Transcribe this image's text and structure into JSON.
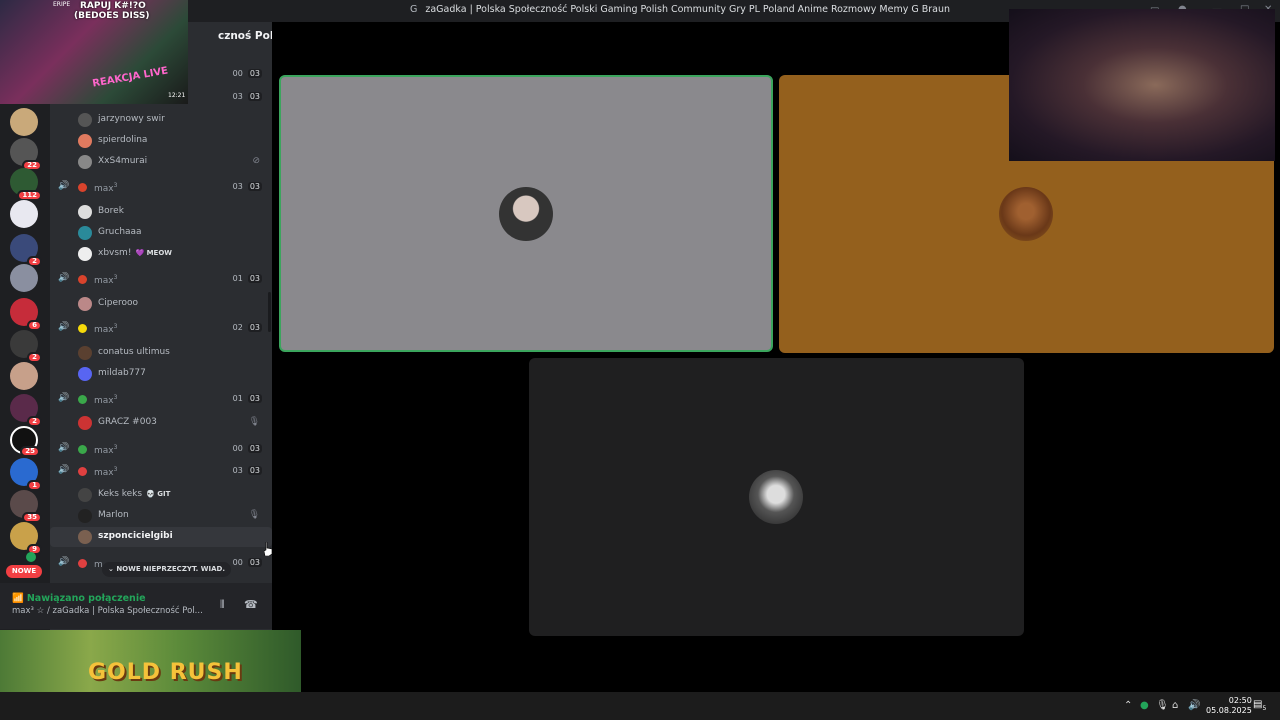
{
  "window": {
    "title_icon": "G",
    "title": "zaGadka | Polska Społeczność Polski Gaming Polish Community Gry PL Poland Anime Rozmowy Memy G Braun",
    "controls": [
      "—",
      "□",
      "✕"
    ]
  },
  "guild": {
    "name": "zaGadka | Polska Społeczność Polski Gaming Polish Community Gry PL Poland Anime Rozmowy Memy G Braun",
    "header_visible": "cznoś Pols..."
  },
  "server_badges": [
    "22",
    "112",
    "2",
    "6",
    "2",
    "2",
    "25",
    "1",
    "35",
    "9"
  ],
  "new_badge": "NOWE",
  "channels": [
    {
      "type": "counts",
      "counts": [
        "00",
        "03"
      ]
    },
    {
      "type": "counts",
      "counts": [
        "03",
        "03"
      ]
    },
    {
      "type": "user",
      "name": "jarzynowy swir"
    },
    {
      "type": "user",
      "name": "spierdolina"
    },
    {
      "type": "user",
      "name": "XxS4murai"
    },
    {
      "type": "channel",
      "name": "max",
      "sup": "3",
      "counts": [
        "03",
        "03"
      ]
    },
    {
      "type": "user",
      "name": "Borek"
    },
    {
      "type": "user",
      "name": "Gruchaaa"
    },
    {
      "type": "user",
      "name": "xbvsm!",
      "tag": "MEOW"
    },
    {
      "type": "channel",
      "name": "max",
      "sup": "3",
      "counts": [
        "01",
        "03"
      ]
    },
    {
      "type": "user",
      "name": "Ciperooo"
    },
    {
      "type": "channel",
      "name": "max",
      "sup": "3",
      "counts": [
        "02",
        "03"
      ]
    },
    {
      "type": "user",
      "name": "conatus ultimus"
    },
    {
      "type": "user",
      "name": "mildab777"
    },
    {
      "type": "channel",
      "name": "max",
      "sup": "3",
      "counts": [
        "01",
        "03"
      ]
    },
    {
      "type": "user",
      "name": "GRACZ #003"
    },
    {
      "type": "channel",
      "name": "max",
      "sup": "3",
      "counts": [
        "00",
        "03"
      ]
    },
    {
      "type": "channel",
      "name": "max",
      "sup": "3",
      "counts": [
        "03",
        "03"
      ]
    },
    {
      "type": "user",
      "name": "Keks keks",
      "tag": "GIT"
    },
    {
      "type": "user",
      "name": "Marlon"
    },
    {
      "type": "user",
      "name": "szponcicielgibi"
    },
    {
      "type": "channel",
      "name": "m",
      "sup": "",
      "counts": [
        "00",
        "03"
      ]
    }
  ],
  "new_messages": "NOWE NIEPRZECZYT. WIAD.",
  "voice": {
    "status": "Nawiązano połączenie",
    "channel": "max³ ☆ / zaGadka | Polska Społeczność Pol..."
  },
  "overlay": {
    "facecam_top": "RAPUJ K#!?O",
    "facecam_sub": "(BEDOES DISS)",
    "streamer": "ERIPE",
    "reakcja": "REAKCJA LIVE",
    "video_time": "12:21",
    "ad": "GOLD RUSH"
  },
  "taskbar": {
    "time": "02:50",
    "date": "05.08.2025",
    "notif_count": "5"
  },
  "colors": {
    "tile_active_border": "#3ba55d",
    "tile1": "#8a898d",
    "tile2": "#94601d",
    "tile3": "#1f1f20"
  }
}
